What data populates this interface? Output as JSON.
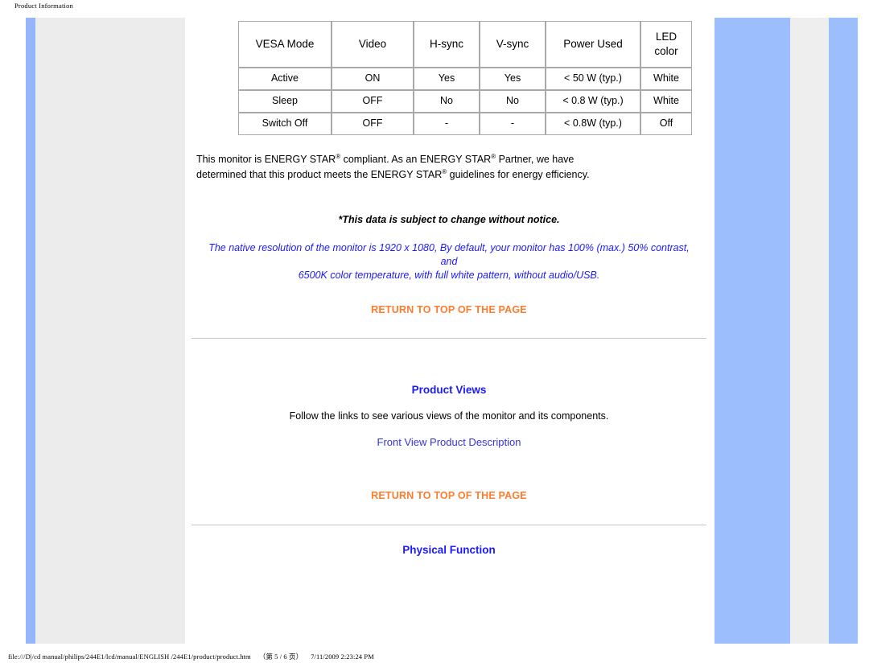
{
  "print_header": {
    "title": "Product Information"
  },
  "print_footer": {
    "path": "file:///D|/cd manual/philips/244E1/lcd/manual/ENGLISH /244E1/product/product.htm",
    "page": "（第 5 / 6 页）",
    "timestamp": "7/11/2009 2:23:24 PM"
  },
  "power_table": {
    "headers": [
      "VESA Mode",
      "Video",
      "H-sync",
      "V-sync",
      "Power Used",
      "LED color"
    ],
    "led_header_line1": "LED",
    "led_header_line2": "color",
    "rows": [
      {
        "mode": "Active",
        "video": "ON",
        "hsync": "Yes",
        "vsync": "Yes",
        "power": "< 50 W (typ.)",
        "led": "White"
      },
      {
        "mode": "Sleep",
        "video": "OFF",
        "hsync": "No",
        "vsync": "No",
        "power": "< 0.8 W (typ.)",
        "led": "White"
      },
      {
        "mode": "Switch Off",
        "video": "OFF",
        "hsync": "-",
        "vsync": "-",
        "power": "< 0.8W (typ.)",
        "led": "Off"
      }
    ]
  },
  "energy_star": {
    "line1_a": "This monitor is ENERGY STAR",
    "line1_b": " compliant. As an ENERGY STAR",
    "line1_c": " Partner, we have",
    "line2_a": "determined that this product meets the ENERGY STAR",
    "line2_b": " guidelines for energy efficiency."
  },
  "notice": "*This data is subject to change without notice.",
  "native_note": {
    "line1": "The native resolution of the monitor is 1920 x 1080, By default, your monitor has 100% (max.) 50% contrast, and",
    "line2": "6500K color temperature, with full white pattern, without audio/USB."
  },
  "links": {
    "return_to_top": "RETURN TO TOP OF THE PAGE",
    "front_view": "Front View Product Description"
  },
  "sections": {
    "product_views_title": "Product Views",
    "product_views_desc": "Follow the links to see various views of the monitor and its components.",
    "physical_function_title": "Physical Function"
  },
  "colors": {
    "link_orange": "#ff7b2e",
    "heading_blue": "#1a1aff",
    "link_blue": "#3333dd",
    "frame_blue": "#9cbefc",
    "frame_gray": "#ececec"
  }
}
